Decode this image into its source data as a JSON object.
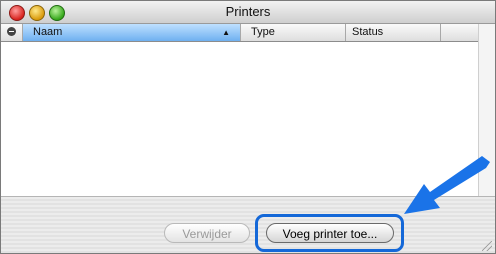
{
  "window": {
    "title": "Printers"
  },
  "columns": {
    "name": "Naam",
    "type": "Type",
    "status": "Status"
  },
  "buttons": {
    "remove": "Verwijder",
    "add": "Voeg printer toe..."
  },
  "icons": [
    "remove-column-icon",
    "sort-ascending-icon",
    "pointer-arrow-icon",
    "resize-grip-icon"
  ],
  "colors": {
    "highlight": "#1468d8",
    "arrow": "#1a73e8",
    "selected_column": "#8cc4f7"
  }
}
